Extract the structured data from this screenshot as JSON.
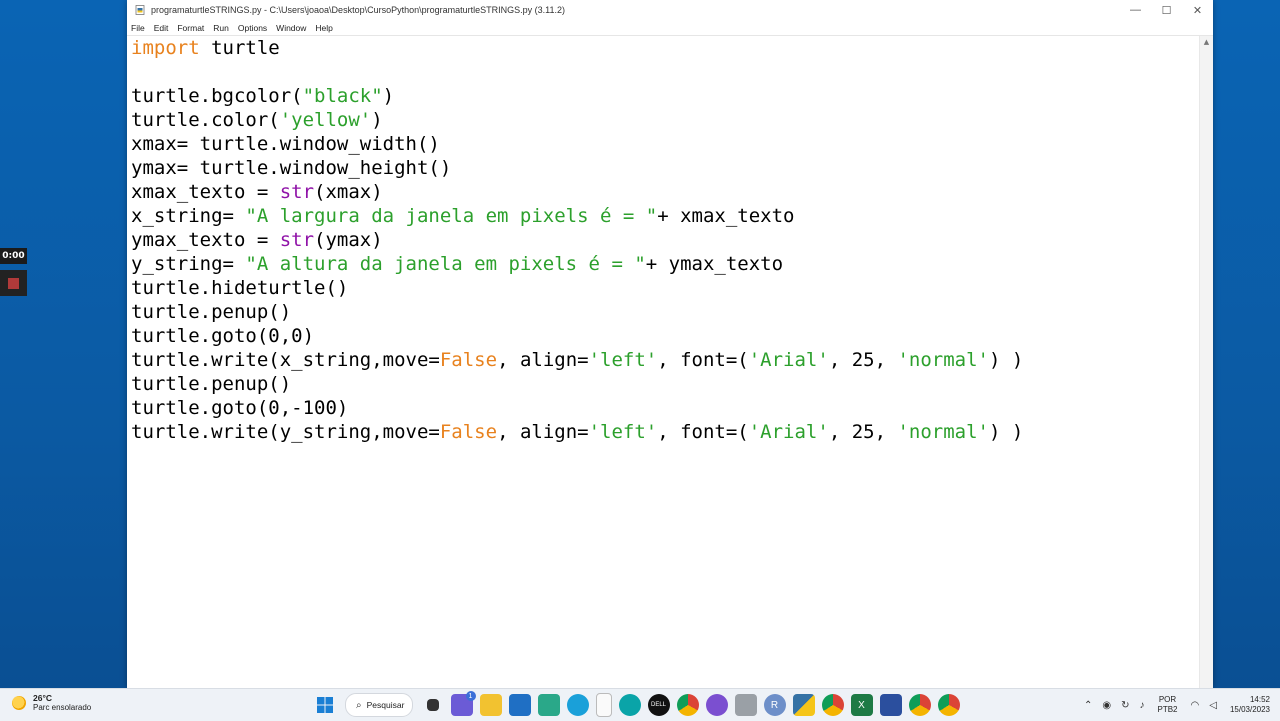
{
  "recording": {
    "time": "0:00"
  },
  "window": {
    "title": "programaturtleSTRINGS.py - C:\\Users\\joaoa\\Desktop\\CursoPython\\programaturtleSTRINGS.py (3.11.2)",
    "controls": {
      "minimize": "—",
      "maximize": "☐",
      "close": "✕"
    }
  },
  "menu": [
    "File",
    "Edit",
    "Format",
    "Run",
    "Options",
    "Window",
    "Help"
  ],
  "code_lines": [
    [
      {
        "t": "import",
        "c": "kw"
      },
      {
        "t": " turtle"
      }
    ],
    [],
    [
      {
        "t": "turtle.bgcolor("
      },
      {
        "t": "\"black\"",
        "c": "str"
      },
      {
        "t": ")"
      }
    ],
    [
      {
        "t": "turtle.color("
      },
      {
        "t": "'yellow'",
        "c": "str"
      },
      {
        "t": ")"
      }
    ],
    [
      {
        "t": "xmax= turtle.window_width()"
      }
    ],
    [
      {
        "t": "ymax= turtle.window_height()"
      }
    ],
    [
      {
        "t": "xmax_texto = "
      },
      {
        "t": "str",
        "c": "bi"
      },
      {
        "t": "(xmax)"
      }
    ],
    [
      {
        "t": "x_string= "
      },
      {
        "t": "\"A largura da janela em pixels é = \"",
        "c": "str"
      },
      {
        "t": "+ xmax_texto"
      }
    ],
    [
      {
        "t": "ymax_texto = "
      },
      {
        "t": "str",
        "c": "bi"
      },
      {
        "t": "(ymax)"
      }
    ],
    [
      {
        "t": "y_string= "
      },
      {
        "t": "\"A altura da janela em pixels é = \"",
        "c": "str"
      },
      {
        "t": "+ ymax_texto"
      }
    ],
    [
      {
        "t": "turtle.hideturtle()"
      }
    ],
    [
      {
        "t": "turtle.penup()"
      }
    ],
    [
      {
        "t": "turtle.goto(0,0)"
      }
    ],
    [
      {
        "t": "turtle.write(x_string,move="
      },
      {
        "t": "False",
        "c": "kw"
      },
      {
        "t": ", align="
      },
      {
        "t": "'left'",
        "c": "str"
      },
      {
        "t": ", font=("
      },
      {
        "t": "'Arial'",
        "c": "str"
      },
      {
        "t": ", 25, "
      },
      {
        "t": "'normal'",
        "c": "str"
      },
      {
        "t": ") )"
      }
    ],
    [
      {
        "t": "turtle.penup()"
      }
    ],
    [
      {
        "t": "turtle.goto(0,-100)"
      }
    ],
    [
      {
        "t": "turtle.write(y_string,move="
      },
      {
        "t": "False",
        "c": "kw"
      },
      {
        "t": ", align="
      },
      {
        "t": "'left'",
        "c": "str"
      },
      {
        "t": ", font=("
      },
      {
        "t": "'Arial'",
        "c": "str"
      },
      {
        "t": ", 25, "
      },
      {
        "t": "'normal'",
        "c": "str"
      },
      {
        "t": ") )"
      }
    ]
  ],
  "colors": {
    "keyword": "#e8821e",
    "string": "#2ca02c",
    "builtin": "#9013a8"
  },
  "taskbar": {
    "weather": {
      "temp": "26°C",
      "desc": "Parc ensolarado",
      "icon": "sun-icon"
    },
    "search_label": "Pesquisar",
    "chat_badge": "1",
    "lang": {
      "line1": "POR",
      "line2": "PTB2"
    },
    "clock": {
      "time": "14:52",
      "date": "15/03/2023"
    }
  }
}
